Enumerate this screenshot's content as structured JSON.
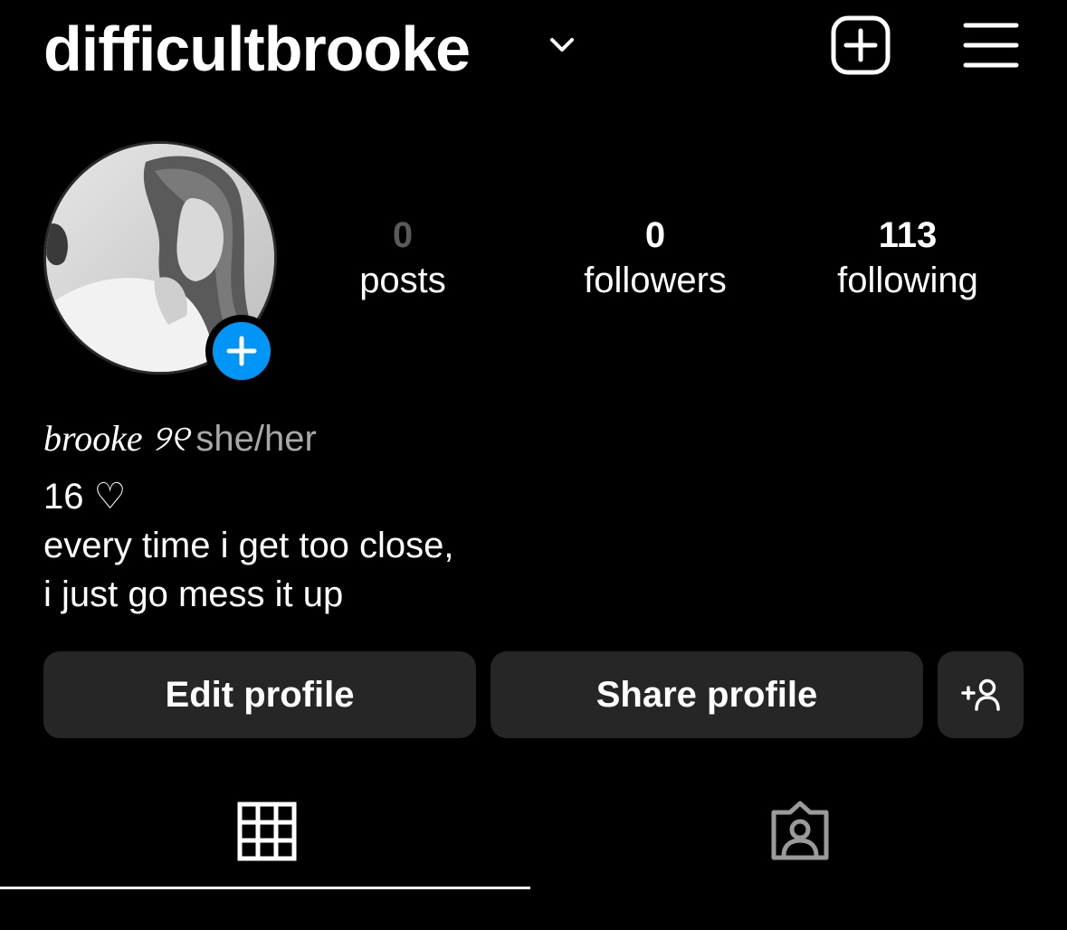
{
  "header": {
    "username": "difficultbrooke",
    "icons": [
      "chevron-down-icon",
      "new-post-icon",
      "menu-icon"
    ]
  },
  "profile": {
    "stats": {
      "posts": {
        "count": "0",
        "label": "posts"
      },
      "followers": {
        "count": "0",
        "label": "followers"
      },
      "following": {
        "count": "113",
        "label": "following"
      }
    },
    "name": "brooke ୨୧",
    "pronouns": "she/her",
    "bio": [
      "16 ♡",
      "every time i get too close,",
      "i just go mess it up"
    ]
  },
  "actions": {
    "edit_label": "Edit profile",
    "share_label": "Share profile",
    "discover_icon": "add-person-icon"
  },
  "tabs": {
    "active": "grid",
    "items": [
      "grid-icon",
      "tagged-icon"
    ]
  },
  "colors": {
    "background": "#000000",
    "button_bg": "#262626",
    "accent_blue": "#0095f6",
    "muted_text": "#a8a8a8"
  }
}
